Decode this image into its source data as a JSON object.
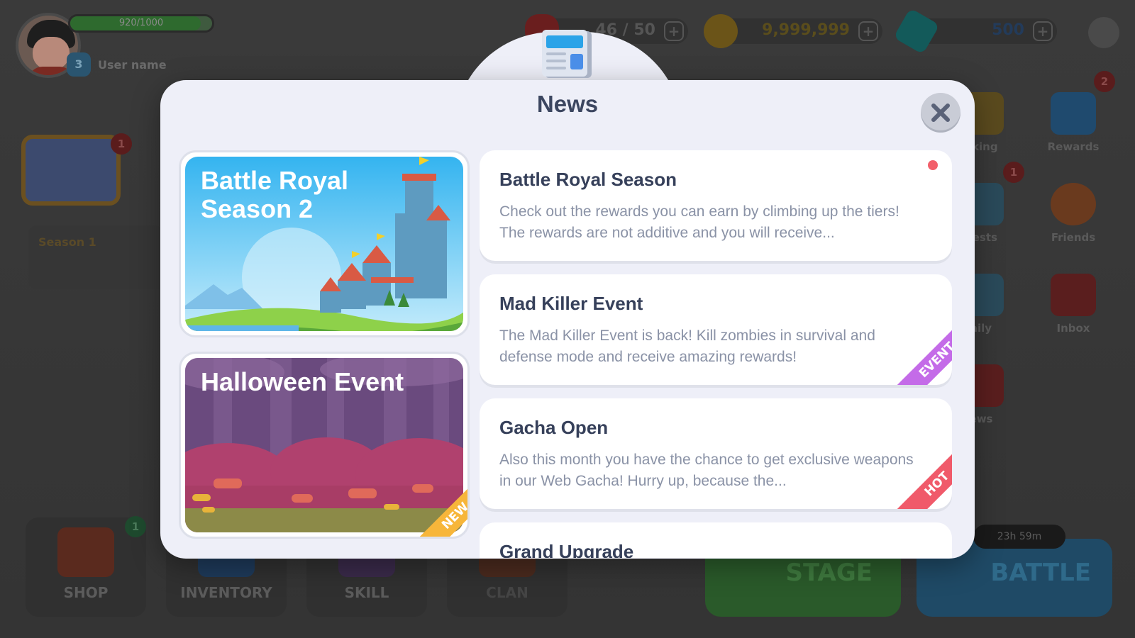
{
  "hud": {
    "xp_text": "920/1000",
    "xp_fraction": 0.92,
    "level": "3",
    "user_name": "User name",
    "hearts": "46 / 50",
    "coins": "9,999,999",
    "gems": "500",
    "plus": "+"
  },
  "side_menu": {
    "ranking": "nking",
    "rewards": "Rewards",
    "rewards_badge": "2",
    "quests": "uests",
    "quests_badge": "1",
    "friends": "Friends",
    "daily": "aily",
    "inbox": "Inbox",
    "news": "ews",
    "chest_badge": "1",
    "season": "Season 1"
  },
  "bottom_bar": {
    "shop": "SHOP",
    "shop_badge": "1",
    "inventory": "INVENTORY",
    "skill": "SKILL",
    "clan": "CLAN",
    "stage": "STAGE",
    "battle": "BATTLE",
    "timer": "23h 59m"
  },
  "modal": {
    "title": "News",
    "banners": [
      {
        "title": "Battle Royal Season 2",
        "ribbon": ""
      },
      {
        "title": "Halloween Event",
        "ribbon": "NEW"
      }
    ],
    "items": [
      {
        "title": "Battle Royal Season",
        "desc": "Check out the rewards you can earn by climbing up the tiers! The rewards are not additive and you will receive...",
        "tag": ""
      },
      {
        "title": "Mad Killer Event",
        "desc": "The Mad Killer Event is back! Kill zombies in survival and defense mode and receive amazing rewards!",
        "tag": "EVENT"
      },
      {
        "title": "Gacha Open",
        "desc": "Also this month you have the chance to get exclusive weapons in our Web Gacha! Hurry up, because the...",
        "tag": "HOT"
      },
      {
        "title": "Grand Upgrade",
        "desc": "",
        "tag": ""
      }
    ]
  },
  "colors": {
    "event_tag": "#c46be8",
    "hot_tag": "#f05a6a",
    "new_tag": "#f7b63a",
    "unread_dot": "#f25f6a"
  }
}
